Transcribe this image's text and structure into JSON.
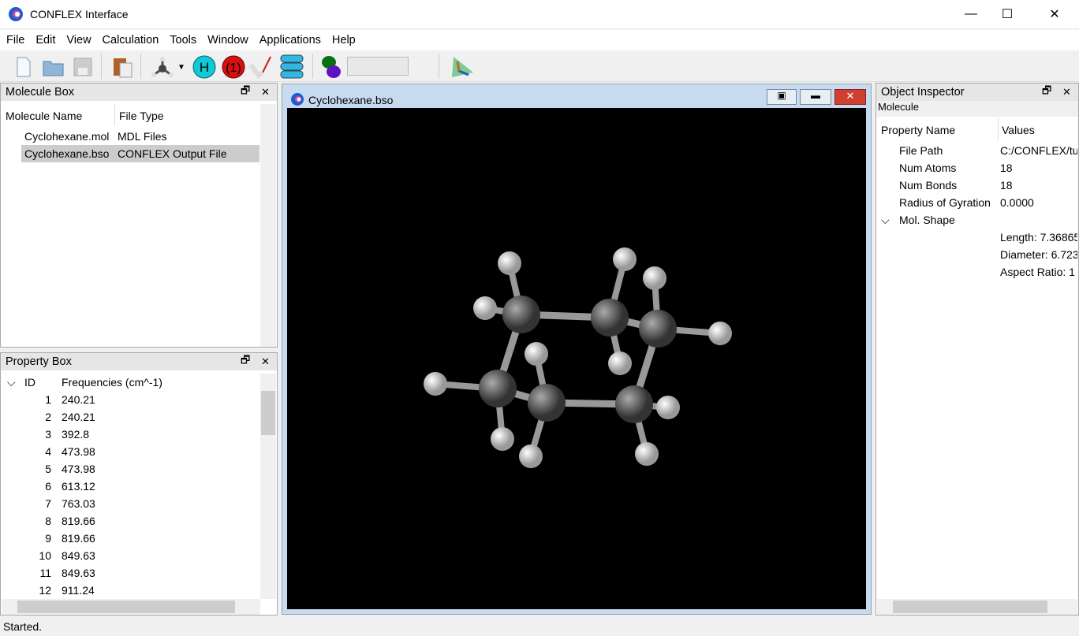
{
  "window": {
    "title": "CONFLEX Interface",
    "minimize": "—",
    "maximize": "☐",
    "close": "✕"
  },
  "menu": [
    "File",
    "Edit",
    "View",
    "Calculation",
    "Tools",
    "Window",
    "Applications",
    "Help"
  ],
  "toolbar": {
    "icons": [
      "new-file-icon",
      "open-folder-icon",
      "save-icon",
      "paste-icon",
      "molecule-icon",
      "hydrogen-icon",
      "charge-icon",
      "wand-icon",
      "layers-icon",
      "orbital-icon",
      "axis-icon"
    ],
    "field_value": ""
  },
  "molecule_box": {
    "title": "Molecule Box",
    "columns": [
      "Molecule Name",
      "File Type"
    ],
    "rows": [
      [
        "Cyclohexane.mol",
        "MDL Files"
      ],
      [
        "Cyclohexane.bso",
        "CONFLEX Output File"
      ]
    ],
    "selected": 1
  },
  "property_box": {
    "title": "Property Box",
    "columns": [
      "ID",
      "Frequencies (cm^-1)"
    ],
    "rows": [
      [
        "1",
        "240.21"
      ],
      [
        "2",
        "240.21"
      ],
      [
        "3",
        "392.8"
      ],
      [
        "4",
        "473.98"
      ],
      [
        "5",
        "473.98"
      ],
      [
        "6",
        "613.12"
      ],
      [
        "7",
        "763.03"
      ],
      [
        "8",
        "819.66"
      ],
      [
        "9",
        "819.66"
      ],
      [
        "10",
        "849.63"
      ],
      [
        "11",
        "849.63"
      ],
      [
        "12",
        "911.24"
      ]
    ]
  },
  "viewer": {
    "title": "Cyclohexane.bso",
    "background": "#000000"
  },
  "inspector": {
    "title": "Object Inspector",
    "subtitle": "Molecule",
    "columns": [
      "Property Name",
      "Values"
    ],
    "rows": [
      [
        "File Path",
        "C:/CONFLEX/tu"
      ],
      [
        "Num Atoms",
        "18"
      ],
      [
        "Num Bonds",
        "18"
      ],
      [
        "Radius of Gyration",
        "0.0000"
      ]
    ],
    "group": "Mol. Shape",
    "group_values": [
      "Length: 7.36865",
      "Diameter: 6.723",
      "Aspect Ratio: 1"
    ]
  },
  "status": "Started.",
  "colors": {
    "selected_row": "#cccccc",
    "panel_header": "#e6e6e6"
  }
}
